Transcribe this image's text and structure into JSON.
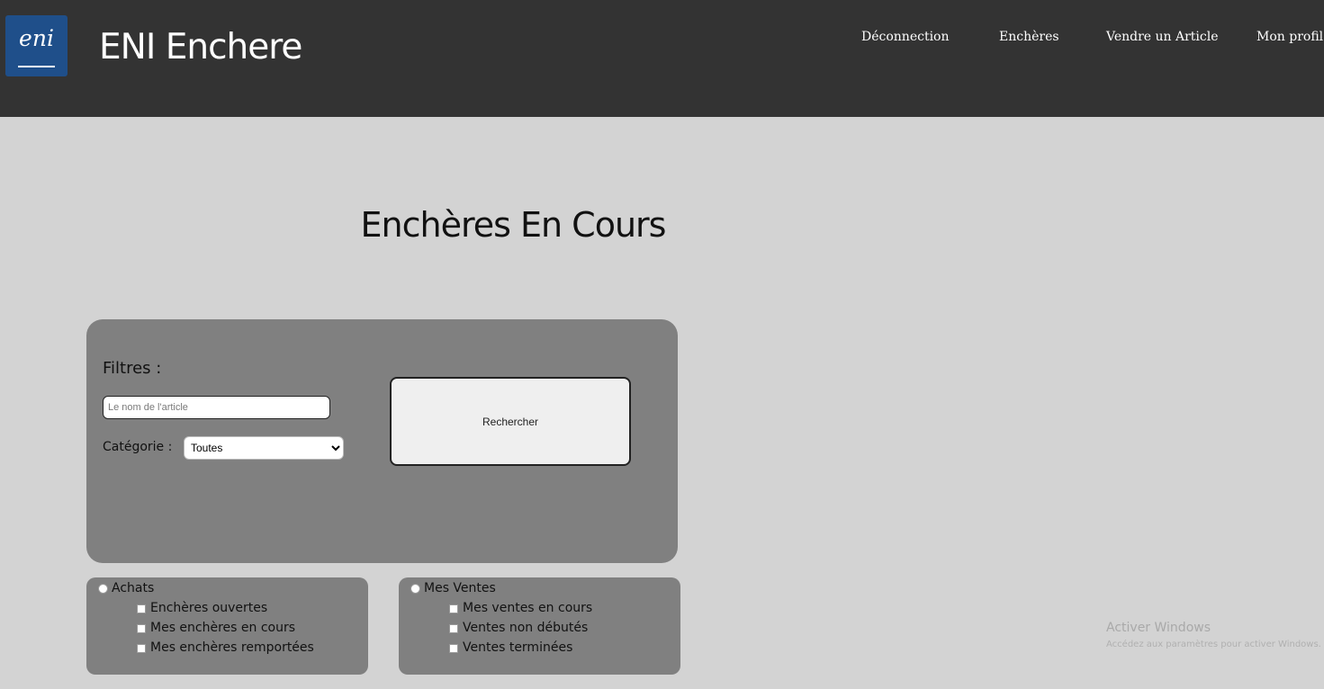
{
  "header": {
    "logo_text": "eni",
    "app_title": "ENI Enchere",
    "nav": {
      "logout": "Déconnection",
      "auctions": "Enchères",
      "sell": "Vendre un Article",
      "profile": "Mon profil"
    }
  },
  "main": {
    "title": "Enchères En Cours",
    "filters": {
      "label": "Filtres :",
      "search_placeholder": "Le nom de l'article",
      "search_value": "",
      "category_label": "Catégorie :",
      "category_selected": "Toutes",
      "search_button": "Rechercher"
    },
    "purchases": {
      "label": "Achats",
      "options": [
        "Enchères ouvertes",
        "Mes enchères en cours",
        "Mes enchères remportées"
      ]
    },
    "sales": {
      "label": "Mes Ventes",
      "options": [
        "Mes ventes en cours",
        "Ventes non débutés",
        "Ventes terminées"
      ]
    }
  },
  "watermark": {
    "title": "Activer Windows",
    "subtitle": "Accédez aux paramètres pour activer Windows."
  },
  "colors": {
    "header_bg": "#333333",
    "page_bg": "#d3d3d3",
    "panel_bg": "#808080",
    "logo_bg": "#1f4f8a"
  }
}
